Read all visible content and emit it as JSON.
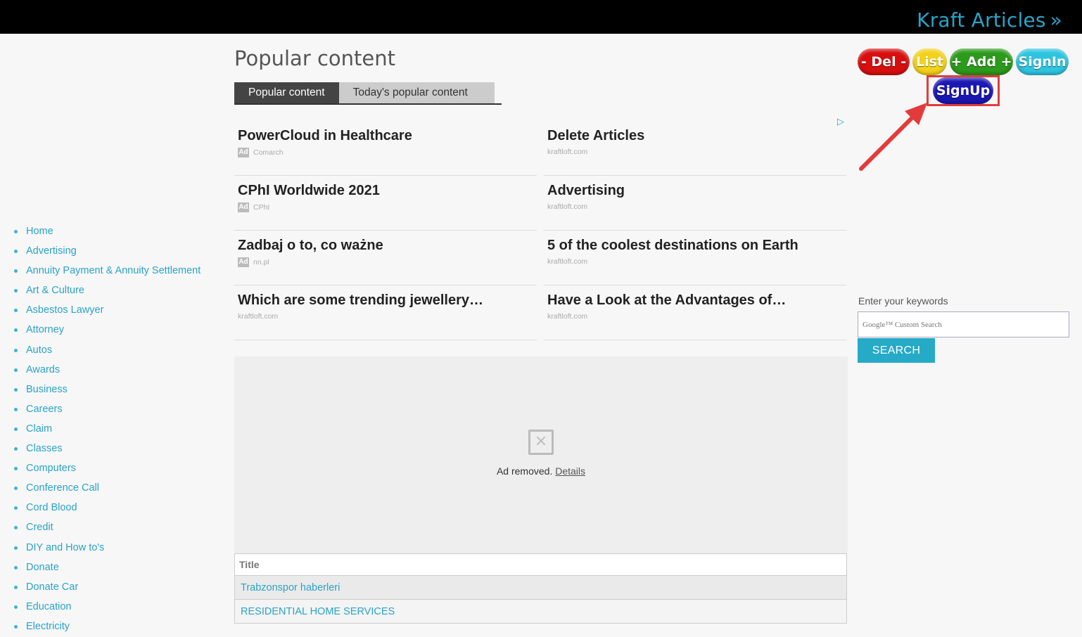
{
  "header": {
    "site_link": "Kraft Articles",
    "chevron": "»"
  },
  "sidebar": {
    "items": [
      {
        "label": "Home"
      },
      {
        "label": "Advertising"
      },
      {
        "label": "Annuity Payment & Annuity Settlement"
      },
      {
        "label": "Art & Culture"
      },
      {
        "label": "Asbestos Lawyer"
      },
      {
        "label": "Attorney"
      },
      {
        "label": "Autos"
      },
      {
        "label": "Awards"
      },
      {
        "label": "Business"
      },
      {
        "label": "Careers"
      },
      {
        "label": "Claim"
      },
      {
        "label": "Classes"
      },
      {
        "label": "Computers"
      },
      {
        "label": "Conference Call"
      },
      {
        "label": "Cord Blood"
      },
      {
        "label": "Credit"
      },
      {
        "label": "DIY and How to's"
      },
      {
        "label": "Donate"
      },
      {
        "label": "Donate Car"
      },
      {
        "label": "Education"
      },
      {
        "label": "Electricity"
      }
    ]
  },
  "main": {
    "title": "Popular content",
    "tabs": [
      {
        "label": "Popular content",
        "active": true
      },
      {
        "label": "Today's popular content",
        "active": false
      }
    ],
    "ads_left": [
      {
        "title": "PowerCloud in Healthcare",
        "badge": "Ad",
        "source": "Comarch"
      },
      {
        "title": "CPhI Worldwide 2021",
        "badge": "Ad",
        "source": "CPhI"
      },
      {
        "title": "Zadbaj o to, co ważne",
        "badge": "Ad",
        "source": "nn.pl"
      },
      {
        "title": "Which are some trending jewellery…",
        "badge": "",
        "source": "kraftloft.com"
      }
    ],
    "ads_right": [
      {
        "title": "Delete Articles",
        "source": "kraftloft.com"
      },
      {
        "title": "Advertising",
        "source": "kraftloft.com"
      },
      {
        "title": "5 of the coolest destinations on Earth",
        "source": "kraftloft.com"
      },
      {
        "title": "Have a Look at the Advantages of…",
        "source": "kraftloft.com"
      }
    ],
    "adchoices_icon": "▷",
    "removed_ad": {
      "text": "Ad removed.",
      "link": "Details"
    },
    "table": {
      "header": "Title",
      "rows": [
        "Trabzonspor haberleri",
        "RESIDENTIAL HOME SERVICES"
      ]
    }
  },
  "right": {
    "buttons": {
      "del": "- Del -",
      "list": "List",
      "add": "+ Add +",
      "signin": "SignIn",
      "signup": "SignUp"
    },
    "search": {
      "label": "Enter your keywords",
      "placeholder": "Google™ Custom Search",
      "button": "SEARCH"
    }
  },
  "colors": {
    "accent": "#2aa3c6",
    "del": "#d80f0f",
    "list": "#f3d21a",
    "add": "#2c9a1b",
    "signin": "#2ec4e0",
    "signup": "#1b17b3",
    "highlight": "#e23b3b"
  }
}
